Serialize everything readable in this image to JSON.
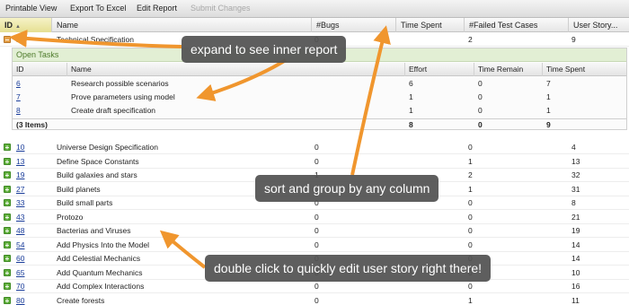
{
  "toolbar": {
    "printable": "Printable View",
    "export": "Export To Excel",
    "edit": "Edit Report",
    "submit": "Submit Changes"
  },
  "columns": {
    "id": "ID",
    "name": "Name",
    "bugs": "#Bugs",
    "time_spent": "Time Spent",
    "failed": "#Failed Test Cases",
    "user_story": "User Story..."
  },
  "expanded_row": {
    "id": "1",
    "name": "Technical Specification",
    "bugs": "0",
    "time_spent": "",
    "failed": "2",
    "user_story": "9"
  },
  "inner_report": {
    "title": "Open Tasks",
    "columns": {
      "id": "ID",
      "name": "Name",
      "effort": "Effort",
      "time_remain": "Time Remain",
      "time_spent": "Time Spent"
    },
    "rows": [
      {
        "id": "6",
        "name": "Research possible scenarios",
        "effort": "6",
        "time_remain": "0",
        "time_spent": "7"
      },
      {
        "id": "7",
        "name": "Prove parameters using model",
        "effort": "1",
        "time_remain": "0",
        "time_spent": "1"
      },
      {
        "id": "8",
        "name": "Create draft specification",
        "effort": "1",
        "time_remain": "0",
        "time_spent": "1"
      }
    ],
    "footer": {
      "label": "(3 Items)",
      "effort": "8",
      "time_remain": "0",
      "time_spent": "9"
    }
  },
  "rows": [
    {
      "id": "10",
      "name": "Universe Design Specification",
      "bugs": "0",
      "failed": "0",
      "user_story": "4"
    },
    {
      "id": "13",
      "name": "Define Space Constants",
      "bugs": "0",
      "failed": "1",
      "user_story": "13"
    },
    {
      "id": "19",
      "name": "Build galaxies and stars",
      "bugs": "1",
      "failed": "2",
      "user_story": "32"
    },
    {
      "id": "27",
      "name": "Build planets",
      "bugs": "0",
      "failed": "1",
      "user_story": "31"
    },
    {
      "id": "33",
      "name": "Build small parts",
      "bugs": "0",
      "failed": "0",
      "user_story": "8"
    },
    {
      "id": "43",
      "name": "Protozo",
      "bugs": "0",
      "failed": "0",
      "user_story": "21"
    },
    {
      "id": "48",
      "name": "Bacterias and Viruses",
      "bugs": "0",
      "failed": "0",
      "user_story": "19"
    },
    {
      "id": "54",
      "name": "Add Physics Into the Model",
      "bugs": "0",
      "failed": "0",
      "user_story": "14"
    },
    {
      "id": "60",
      "name": "Add Celestial Mechanics",
      "bugs": "0",
      "failed": "0",
      "user_story": "14"
    },
    {
      "id": "65",
      "name": "Add Quantum Mechanics",
      "bugs": "0",
      "failed": "0",
      "user_story": "10"
    },
    {
      "id": "70",
      "name": "Add Complex Interactions",
      "bugs": "0",
      "failed": "0",
      "user_story": "16"
    },
    {
      "id": "80",
      "name": "Create forests",
      "bugs": "0",
      "failed": "1",
      "user_story": "11"
    }
  ],
  "callouts": {
    "expand": "expand to see inner report",
    "sort": "sort and group by any column",
    "edit": "double click to quickly edit user story right there!"
  },
  "colors": {
    "arrow": "#f0962e",
    "callout_bg": "#525252",
    "link": "#1a3d9a"
  }
}
